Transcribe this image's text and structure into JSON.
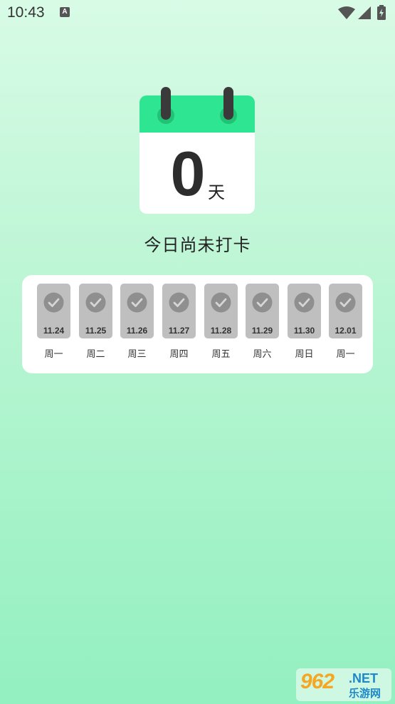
{
  "status_bar": {
    "time": "10:43",
    "notification_icon": "A"
  },
  "calendar": {
    "count": "0",
    "unit": "天"
  },
  "checkin_status": "今日尚未打卡",
  "week": [
    {
      "date": "11.24",
      "weekday": "周一"
    },
    {
      "date": "11.25",
      "weekday": "周二"
    },
    {
      "date": "11.26",
      "weekday": "周三"
    },
    {
      "date": "11.27",
      "weekday": "周四"
    },
    {
      "date": "11.28",
      "weekday": "周五"
    },
    {
      "date": "11.29",
      "weekday": "周六"
    },
    {
      "date": "11.30",
      "weekday": "周日"
    },
    {
      "date": "12.01",
      "weekday": "周一"
    }
  ],
  "watermark": {
    "logo": "962",
    "domain": ".NET",
    "name": "乐游网"
  },
  "colors": {
    "accent_green": "#2ee591",
    "tile_gray": "#bfbfbf"
  }
}
